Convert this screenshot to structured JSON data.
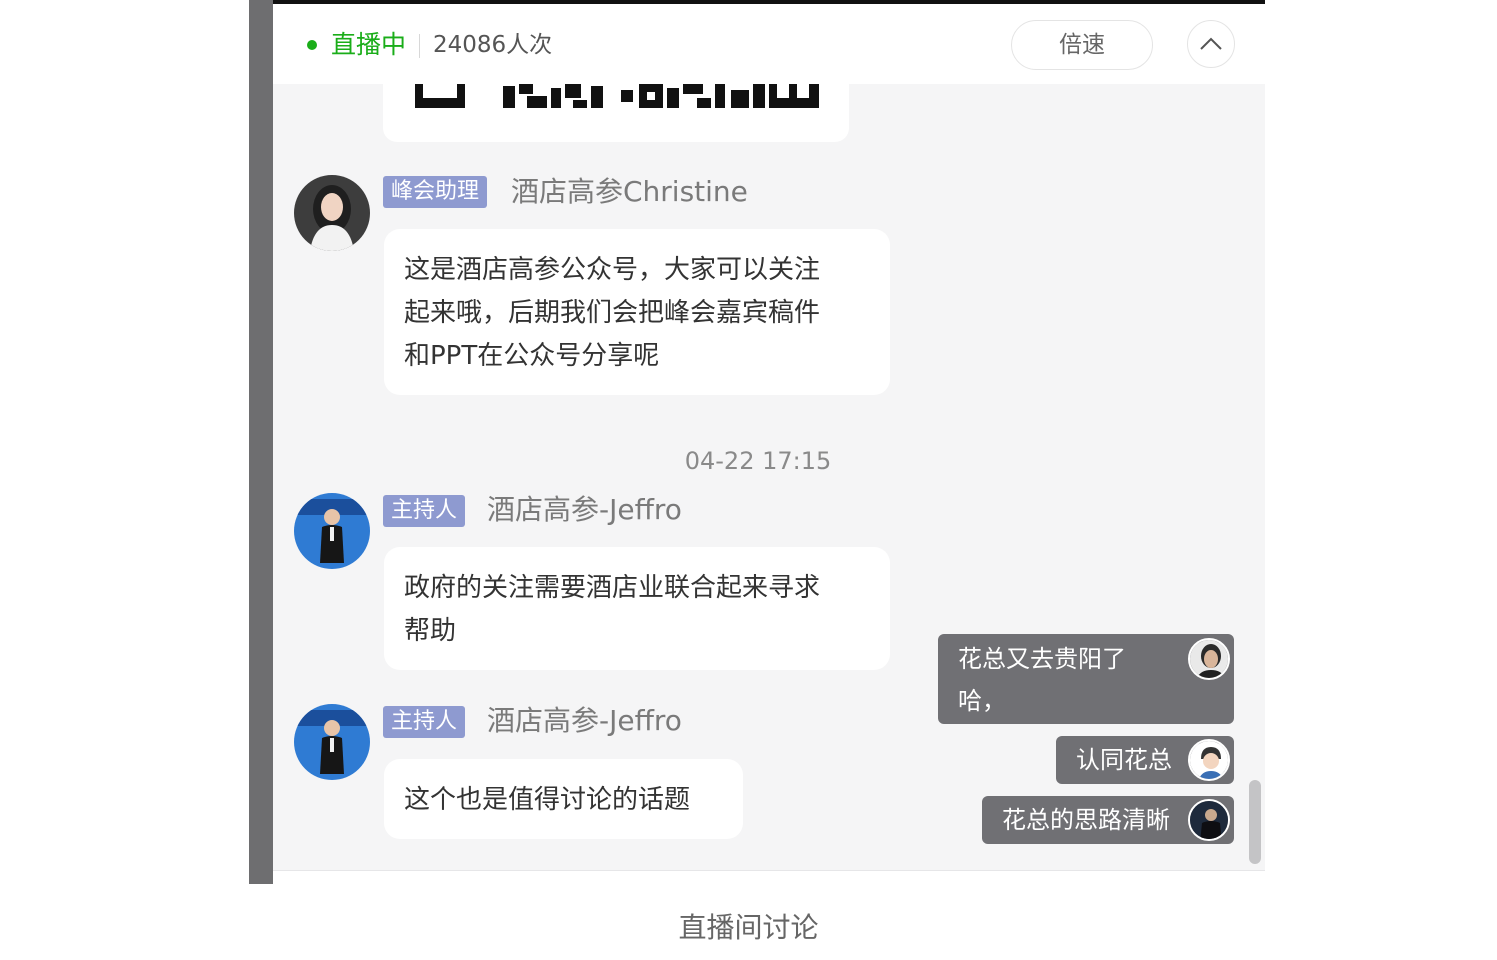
{
  "header": {
    "live_label": "直播中",
    "viewers": "24086人次",
    "speed_label": "倍速",
    "colors": {
      "live": "#1aad19"
    }
  },
  "messages": [
    {
      "badge": "峰会助理",
      "sender": "酒店高参Christine",
      "lines": [
        "这是酒店高参公众号，大家可以关注",
        "起来哦，后期我们会把峰会嘉宾稿件",
        "和PPT在公众号分享呢"
      ]
    },
    {
      "badge": "主持人",
      "sender": "酒店高参-Jeffro",
      "lines": [
        "政府的关注需要酒店业联合起来寻求",
        "帮助"
      ]
    },
    {
      "badge": "主持人",
      "sender": "酒店高参-Jeffro",
      "lines": [
        "这个也是值得讨论的话题"
      ]
    }
  ],
  "timestamp": "04-22 17:15",
  "danmaku": [
    {
      "lines": [
        "花总又去贵阳了",
        "哈，"
      ]
    },
    {
      "lines": [
        "认同花总"
      ]
    },
    {
      "lines": [
        "花总的思路清晰"
      ]
    }
  ],
  "caption": "直播间讨论"
}
